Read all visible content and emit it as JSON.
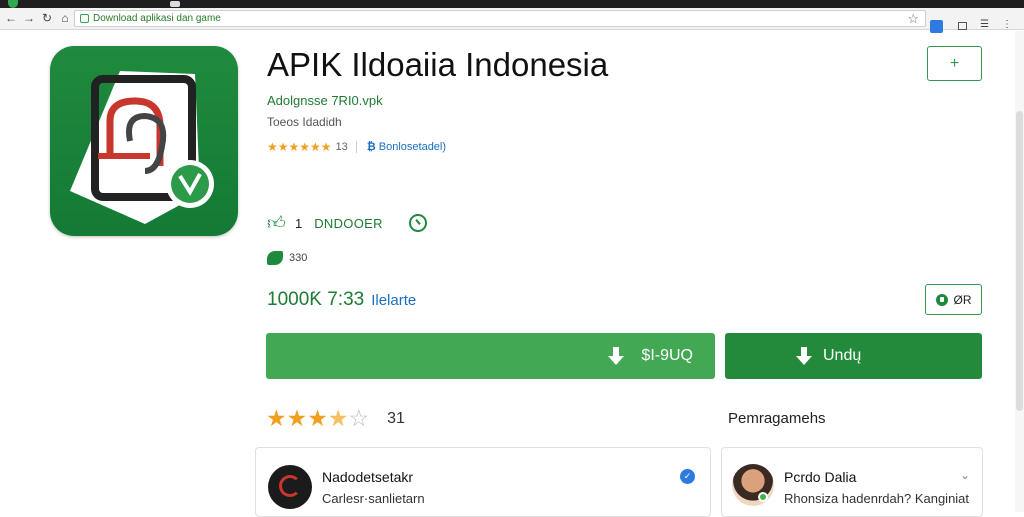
{
  "browser": {
    "url": "Download aplikasi dan game",
    "back_icon": "arrow-left-icon",
    "forward_icon": "arrow-right-icon",
    "reload_icon": "reload-icon",
    "bookmark_icon": "star-icon"
  },
  "app": {
    "title": "APIK Ildoaiia Indonesia",
    "developer": "Adolgnsse 7RI0.vpk",
    "category": "Toeos Idadidh",
    "rating_stars": "★★★★★★",
    "rating_value": "13",
    "installs_link_icon": "₿",
    "installs_link": "Bonlosetadel)",
    "badge_count": "1",
    "badge_label": "DNDOOER",
    "small_count": "330",
    "price": "1000Ƙ 7:33",
    "price_note": "Ilelarte",
    "ok_label": "ØR",
    "wishlist_symbol": "+",
    "colors": {
      "accent": "#238a3b",
      "light_accent": "#43a853",
      "star": "#f0a020",
      "link": "#1a6fc0"
    }
  },
  "buttons": {
    "install_label": "$I-9UQ",
    "download_label": "Undų"
  },
  "reviews": {
    "stars_filled": "★★★",
    "star_half": "★",
    "stars_empty": "☆",
    "count": "31",
    "permissions_label": "Pemragamehs"
  },
  "cards": [
    {
      "name": "Nadodetsetakr",
      "subtitle": "Carlesr·sanlietarn",
      "verified": "✓"
    },
    {
      "name": "Pcrdo Dalia",
      "subtitle": "Rhonsiza hadenrdah? Kanginiat",
      "chevron": "⌄"
    }
  ]
}
